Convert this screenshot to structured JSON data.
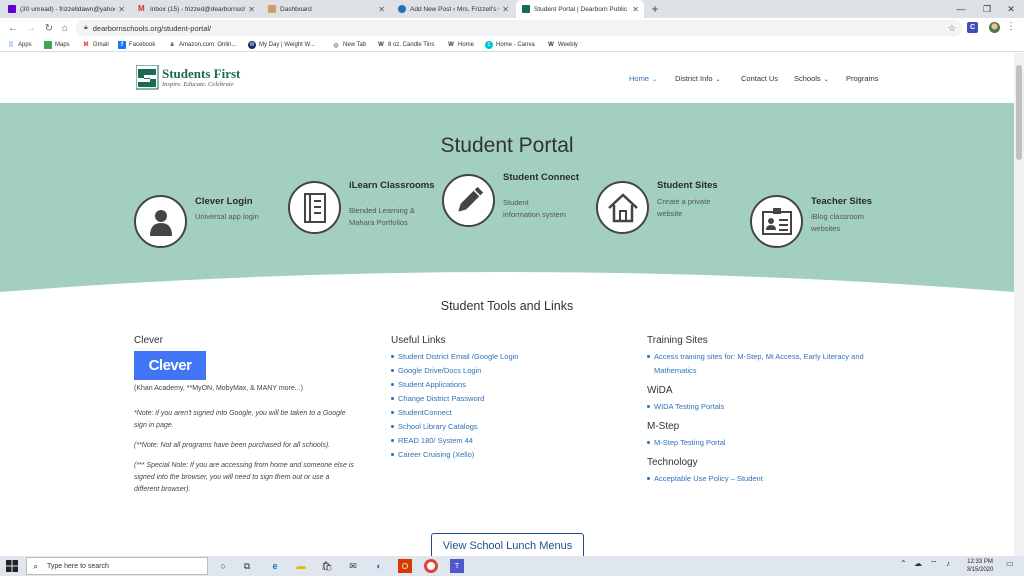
{
  "browser": {
    "tabs": [
      {
        "title": "(30 unread) - frizzelldawn@yahoo",
        "icon": "yahoo-mail-icon",
        "color": "#6001d2"
      },
      {
        "title": "Inbox (15) - frizzed@dearbornscho",
        "icon": "gmail-icon",
        "color": "#d93025"
      },
      {
        "title": "Dashboard",
        "icon": "dashboard-icon",
        "color": "#8b5a2b"
      },
      {
        "title": "Add New Post ‹ Mrs. Frizzell's Cl",
        "icon": "wordpress-icon",
        "color": "#2271b1"
      },
      {
        "title": "Student Portal | Dearborn Public",
        "icon": "district-icon",
        "color": "#1b6a55"
      }
    ],
    "url": "dearbornschools.org/student-portal/",
    "bookmarks": [
      "Apps",
      "Maps",
      "Gmail",
      "Facebook",
      "Amazon.com: Onlin...",
      "My Day | Weight W...",
      "New Tab",
      "8 oz. Candle Tins",
      "Home",
      "Home - Canva",
      "Weebly"
    ]
  },
  "header": {
    "brand": "Students First",
    "tagline": "Inspire. Educate. Celebrate",
    "nav": [
      {
        "label": "Home",
        "dropdown": true
      },
      {
        "label": "District Info",
        "dropdown": true
      },
      {
        "label": "Contact Us",
        "dropdown": false
      },
      {
        "label": "Schools",
        "dropdown": true
      },
      {
        "label": "Programs",
        "dropdown": false
      }
    ]
  },
  "hero": {
    "title": "Student Portal",
    "cards": [
      {
        "title": "Clever Login",
        "subtitle": [
          "Universal app login"
        ],
        "icon": "user-icon"
      },
      {
        "title": "iLearn Classrooms",
        "subtitle": [
          "Blended Learning &",
          "Mahara Portfolios"
        ],
        "icon": "notebook-icon"
      },
      {
        "title": "Student Connect",
        "subtitle": [
          "Student",
          "information system"
        ],
        "icon": "pencil-icon"
      },
      {
        "title": "Student Sites",
        "subtitle": [
          "Create a private",
          "website"
        ],
        "icon": "house-icon"
      },
      {
        "title": "Teacher Sites",
        "subtitle": [
          "iBlog classroom",
          "websites"
        ],
        "icon": "id-badge-icon"
      }
    ]
  },
  "tools": {
    "title": "Student Tools and Links",
    "clever": {
      "heading": "Clever",
      "logo_text": "Clever",
      "apps_note": "(Khan Academy, **MyON, MobyMax, & MANY more...)",
      "note1": [
        "*Note: if you aren't signed into Google, you will be taken to a Google",
        "sign in page."
      ],
      "note2": "(**Note: Not all programs have been purchased for all schools).",
      "note3": [
        "(*** Special Note: If you are accessing from home and someone else is",
        "signed into the browser, you will need to sign them out or use a",
        "different browser)."
      ]
    },
    "useful_links": {
      "heading": "Useful Links",
      "items": [
        "Student District Email /Google Login",
        "Google Drive/Docs Login",
        "Student Applications",
        "Change District Password",
        "StudentConnect",
        "School Library Catalogs",
        "READ 180/ System 44",
        "Career Cruising (Xello)"
      ]
    },
    "training": {
      "heading": "Training Sites",
      "items": [
        [
          "Access training sites for: M-Step, Mi Access, Early Literacy and",
          "Mathematics"
        ]
      ]
    },
    "wida": {
      "heading": "WiDA",
      "items": [
        "WIDA Testing Portals"
      ]
    },
    "mstep": {
      "heading": "M-Step",
      "items": [
        "M-Step Testing Portal"
      ]
    },
    "technology": {
      "heading": "Technology",
      "items": [
        "Acceptable Use Policy – Student"
      ]
    }
  },
  "lunch_button": "View School Lunch Menus",
  "taskbar": {
    "search_placeholder": "Type here to search",
    "time": "12:33 PM",
    "date": "3/15/2020"
  },
  "colors": {
    "hero_bg": "#a3cfc1",
    "link": "#2e72b8",
    "brand_green": "#1b6a55",
    "clever_blue": "#4274f6"
  }
}
